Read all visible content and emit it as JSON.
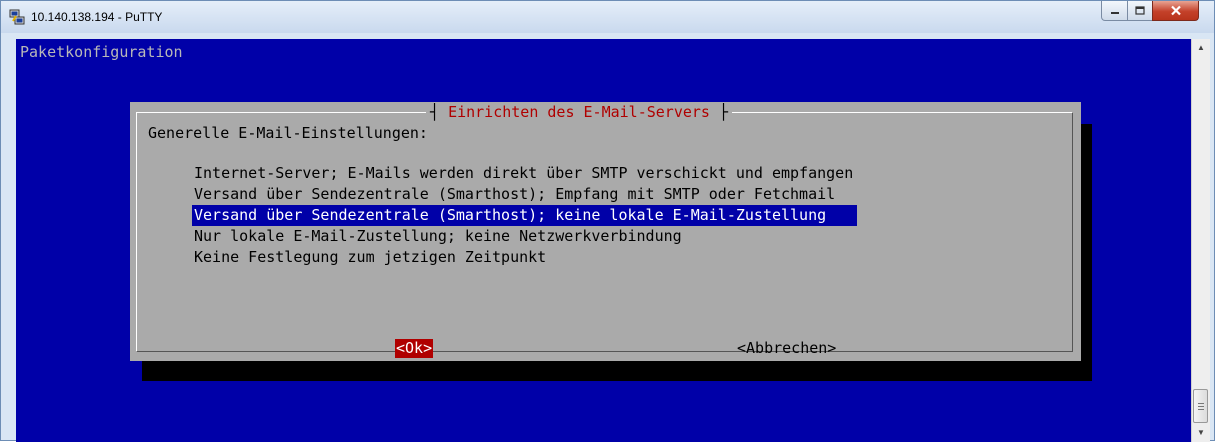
{
  "window": {
    "title": "10.140.138.194 - PuTTY",
    "icon": "putty-icon"
  },
  "terminal": {
    "header": "Paketkonfiguration",
    "background_color": "#0000a8",
    "dialog": {
      "title": "Einrichten des E-Mail-Servers",
      "label": "Generelle E-Mail-Einstellungen:",
      "options": [
        "Internet-Server; E-Mails werden direkt über SMTP verschickt und empfangen",
        "Versand über Sendezentrale (Smarthost); Empfang mit SMTP oder Fetchmail",
        "Versand über Sendezentrale (Smarthost); keine lokale E-Mail-Zustellung",
        "Nur lokale E-Mail-Zustellung; keine Netzwerkverbindung",
        "Keine Festlegung zum jetzigen Zeitpunkt"
      ],
      "selected_option": 2,
      "ok_label": "<Ok>",
      "cancel_label": "<Abbrechen>"
    }
  },
  "colors": {
    "dialog_title": "#b00000",
    "selection": "#0000a8",
    "ok_button": "#b00000",
    "dialog_background": "#aaaaaa"
  }
}
